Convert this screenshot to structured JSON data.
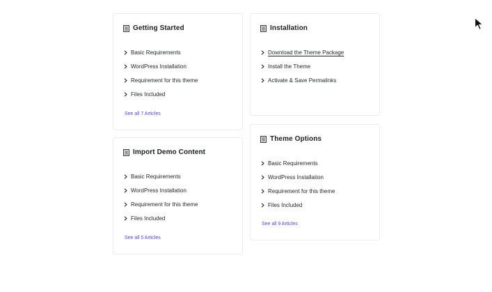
{
  "cards": {
    "getting_started": {
      "icon": "document-icon",
      "title": "Getting Started",
      "items": [
        "Basic Requirements",
        "WordPress Installation",
        "Requirement for this theme",
        "Files Included"
      ],
      "see_all": "See all 7 Articles"
    },
    "installation": {
      "icon": "document-icon",
      "title": "Installation",
      "items": [
        "Download the Theme Package",
        "Install the Theme",
        "Activate & Save Permalinks"
      ]
    },
    "import_demo": {
      "icon": "document-icon",
      "title": "Import Demo Content",
      "items": [
        "Basic Requirements",
        "WordPress Installation",
        "Requirement for this theme",
        "Files Included"
      ],
      "see_all": "See all 5 Articles"
    },
    "theme_options": {
      "icon": "document-icon",
      "title": "Theme Options",
      "items": [
        "Basic Requirements",
        "WordPress Installation",
        "Requirement for this theme",
        "Files Included"
      ],
      "see_all": "See all 9 Articles"
    }
  },
  "colors": {
    "link": "#4f46e5",
    "border": "#ececec",
    "text": "#1f2328"
  },
  "cursor": "arrow-cursor-icon"
}
